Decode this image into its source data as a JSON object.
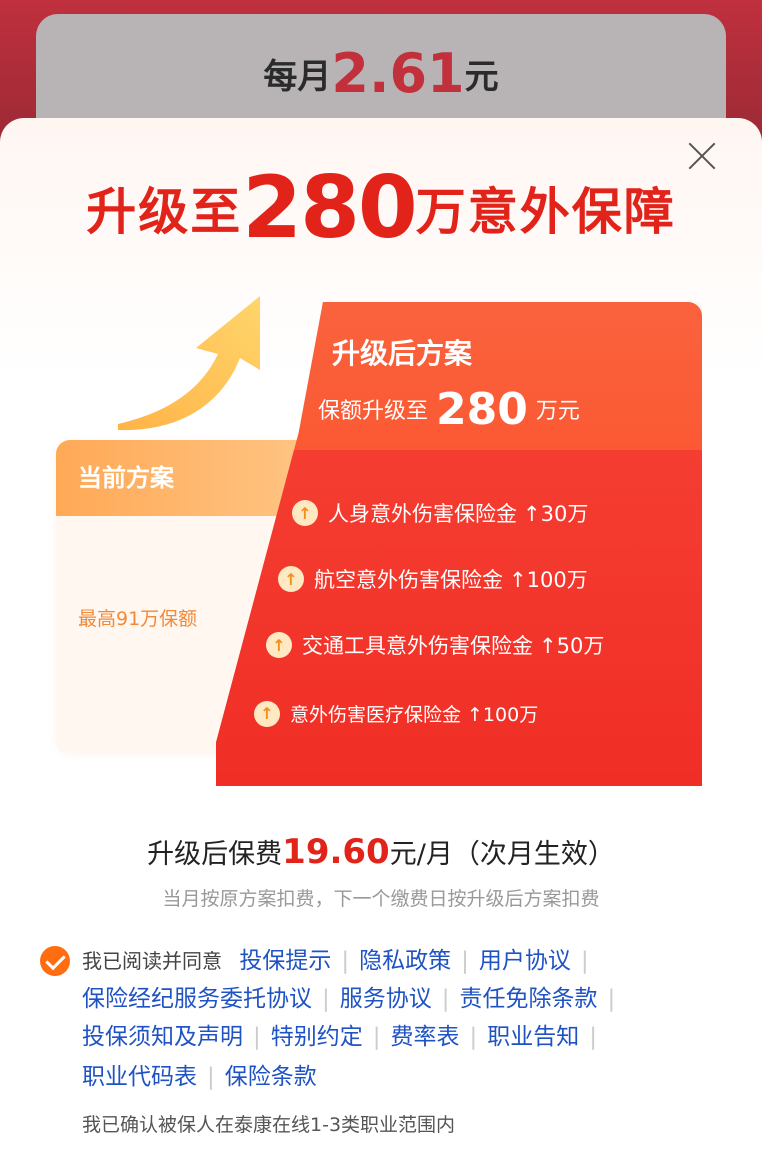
{
  "background": {
    "price_prefix": "每月",
    "price_value": "2.61",
    "price_unit": "元"
  },
  "headline": {
    "prefix": "升级至",
    "amount": "280",
    "suffix": "万意外保障"
  },
  "current_plan": {
    "title": "当前方案",
    "subtitle": "最高91万保额"
  },
  "upgraded_plan": {
    "title": "升级后方案",
    "sub_prefix": "保额升级至",
    "sub_amount": "280",
    "sub_unit": "万元",
    "benefits": [
      {
        "label": "人身意外伤害保险金",
        "change": "↑30万"
      },
      {
        "label": "航空意外伤害保险金",
        "change": "↑100万"
      },
      {
        "label": "交通工具意外伤害保险金",
        "change": "↑50万"
      },
      {
        "label": "意外伤害医疗保险金",
        "change": "↑100万"
      }
    ]
  },
  "fee": {
    "prefix": "升级后保费",
    "price": "19.60",
    "suffix": "元/月（次月生效）",
    "note": "当月按原方案扣费，下一个缴费日按升级后方案扣费"
  },
  "agreement": {
    "lead": "我已阅读并同意",
    "links": [
      "投保提示",
      "隐私政策",
      "用户协议",
      "保险经纪服务委托协议",
      "服务协议",
      "责任免除条款",
      "投保须知及声明",
      "特别约定",
      "费率表",
      "职业告知",
      "职业代码表",
      "保险条款"
    ],
    "confirm": "我已确认被保人在泰康在线1-3类职业范围内"
  },
  "colors": {
    "accent": "#e2231a",
    "link": "#1f53c4",
    "checkbox": "#ff6d10"
  }
}
